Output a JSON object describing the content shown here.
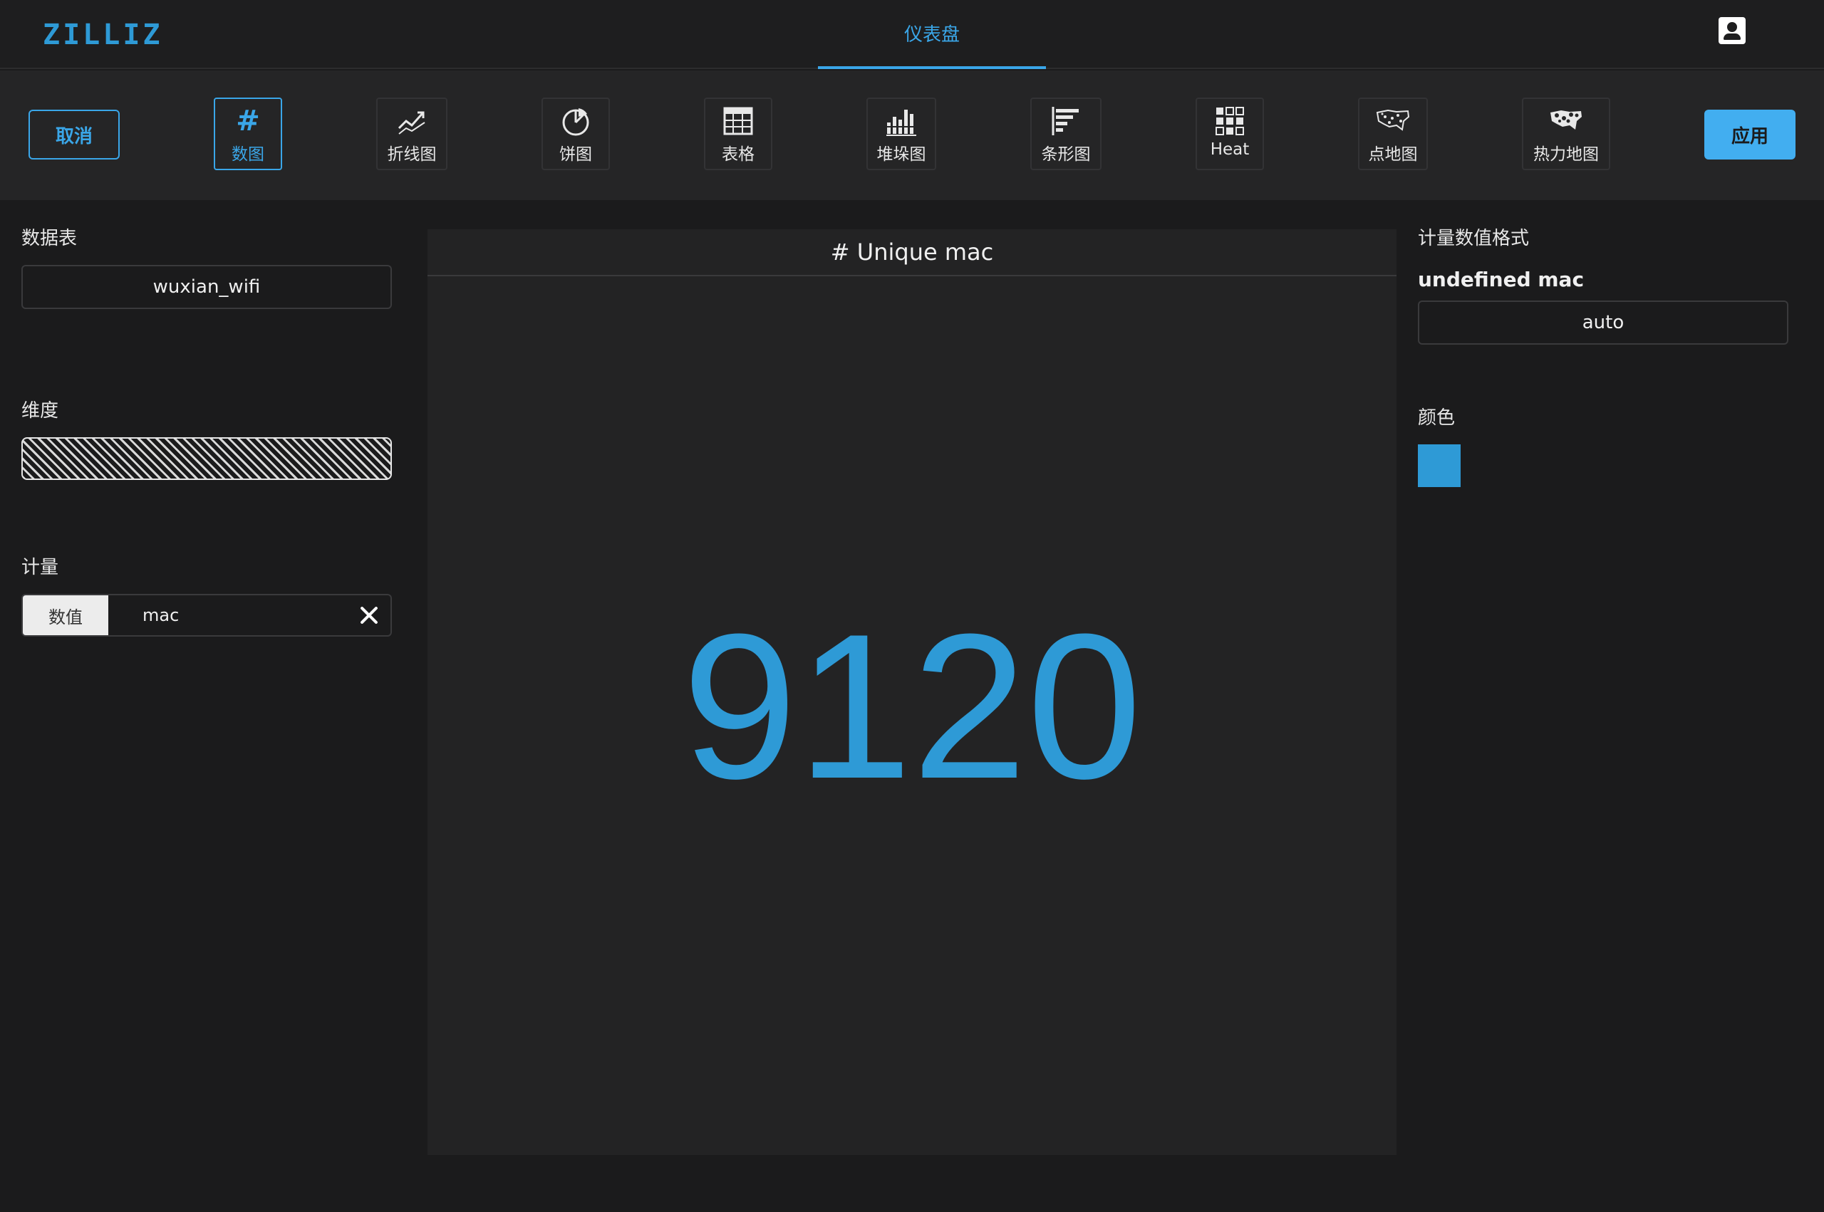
{
  "header": {
    "logo": "ZILLIZ",
    "nav_tab": "仪表盘"
  },
  "toolbar": {
    "cancel_label": "取消",
    "apply_label": "应用",
    "chart_types": [
      {
        "label": "数图",
        "icon": "hash-icon",
        "active": true
      },
      {
        "label": "折线图",
        "icon": "line-chart-icon",
        "active": false
      },
      {
        "label": "饼图",
        "icon": "pie-chart-icon",
        "active": false
      },
      {
        "label": "表格",
        "icon": "table-icon",
        "active": false
      },
      {
        "label": "堆垛图",
        "icon": "stacked-bar-icon",
        "active": false
      },
      {
        "label": "条形图",
        "icon": "bar-chart-icon",
        "active": false
      },
      {
        "label": "Heat",
        "icon": "heat-grid-icon",
        "active": false
      },
      {
        "label": "点地图",
        "icon": "point-map-icon",
        "active": false
      },
      {
        "label": "热力地图",
        "icon": "heat-map-icon",
        "active": false
      }
    ]
  },
  "left_panel": {
    "table_label": "数据表",
    "table_value": "wuxian_wifi",
    "dimension_label": "维度",
    "measure_label": "计量",
    "measure_tag": "数值",
    "measure_value": "mac"
  },
  "preview": {
    "hash": "#",
    "title": "Unique mac",
    "value": "9120"
  },
  "right_panel": {
    "format_label": "计量数值格式",
    "format_name": "undefined mac",
    "format_value": "auto",
    "color_label": "颜色",
    "color_value": "#2e9ad6"
  },
  "colors": {
    "accent": "#3aa6e8",
    "number": "#2e9ad6",
    "apply_button": "#42aef0",
    "background": "#1b1b1c"
  }
}
